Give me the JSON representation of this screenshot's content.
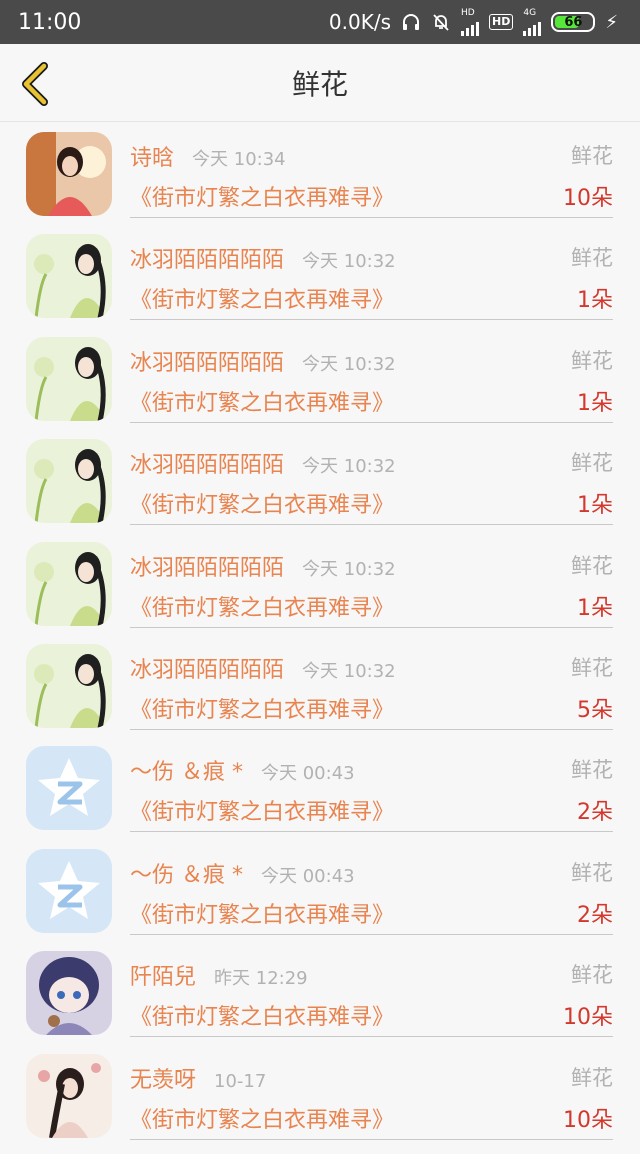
{
  "status": {
    "time": "11:00",
    "speed": "0.0K/s",
    "hd1": "HD",
    "hd2": "HD",
    "net": "4G",
    "battery": "66",
    "battery_level": 0.66,
    "colors": {
      "bar": "#4a4a4a",
      "battery": "#57e63a"
    }
  },
  "nav": {
    "title": "鲜花",
    "back_icon": "chevron-left-icon",
    "back_color": "#e8c230"
  },
  "colors": {
    "name": "#e8844f",
    "count": "#d3382c",
    "muted": "#b2b2b2"
  },
  "items": [
    {
      "avatar": "portrait-red",
      "name": "诗晗",
      "time": "今天 10:34",
      "gift": "鲜花",
      "book": "《街市灯繁之白衣再难寻》",
      "count": "10朵"
    },
    {
      "avatar": "portrait-green",
      "name": "冰羽陌陌陌陌陌",
      "time": "今天 10:32",
      "gift": "鲜花",
      "book": "《街市灯繁之白衣再难寻》",
      "count": "1朵"
    },
    {
      "avatar": "portrait-green",
      "name": "冰羽陌陌陌陌陌",
      "time": "今天 10:32",
      "gift": "鲜花",
      "book": "《街市灯繁之白衣再难寻》",
      "count": "1朵"
    },
    {
      "avatar": "portrait-green",
      "name": "冰羽陌陌陌陌陌",
      "time": "今天 10:32",
      "gift": "鲜花",
      "book": "《街市灯繁之白衣再难寻》",
      "count": "1朵"
    },
    {
      "avatar": "portrait-green",
      "name": "冰羽陌陌陌陌陌",
      "time": "今天 10:32",
      "gift": "鲜花",
      "book": "《街市灯繁之白衣再难寻》",
      "count": "1朵"
    },
    {
      "avatar": "portrait-green",
      "name": "冰羽陌陌陌陌陌",
      "time": "今天 10:32",
      "gift": "鲜花",
      "book": "《街市灯繁之白衣再难寻》",
      "count": "5朵"
    },
    {
      "avatar": "qzone-default",
      "name": "～伤 ＆痕 *",
      "time": "今天 00:43",
      "gift": "鲜花",
      "book": "《街市灯繁之白衣再难寻》",
      "count": "2朵"
    },
    {
      "avatar": "qzone-default",
      "name": "～伤 ＆痕 *",
      "time": "今天 00:43",
      "gift": "鲜花",
      "book": "《街市灯繁之白衣再难寻》",
      "count": "2朵"
    },
    {
      "avatar": "anime-chibi",
      "name": "阡陌兒",
      "time": "昨天 12:29",
      "gift": "鲜花",
      "book": "《街市灯繁之白衣再难寻》",
      "count": "10朵"
    },
    {
      "avatar": "portrait-flowers",
      "name": "无羡呀",
      "time": "10-17",
      "gift": "鲜花",
      "book": "《街市灯繁之白衣再难寻》",
      "count": "10朵"
    }
  ]
}
